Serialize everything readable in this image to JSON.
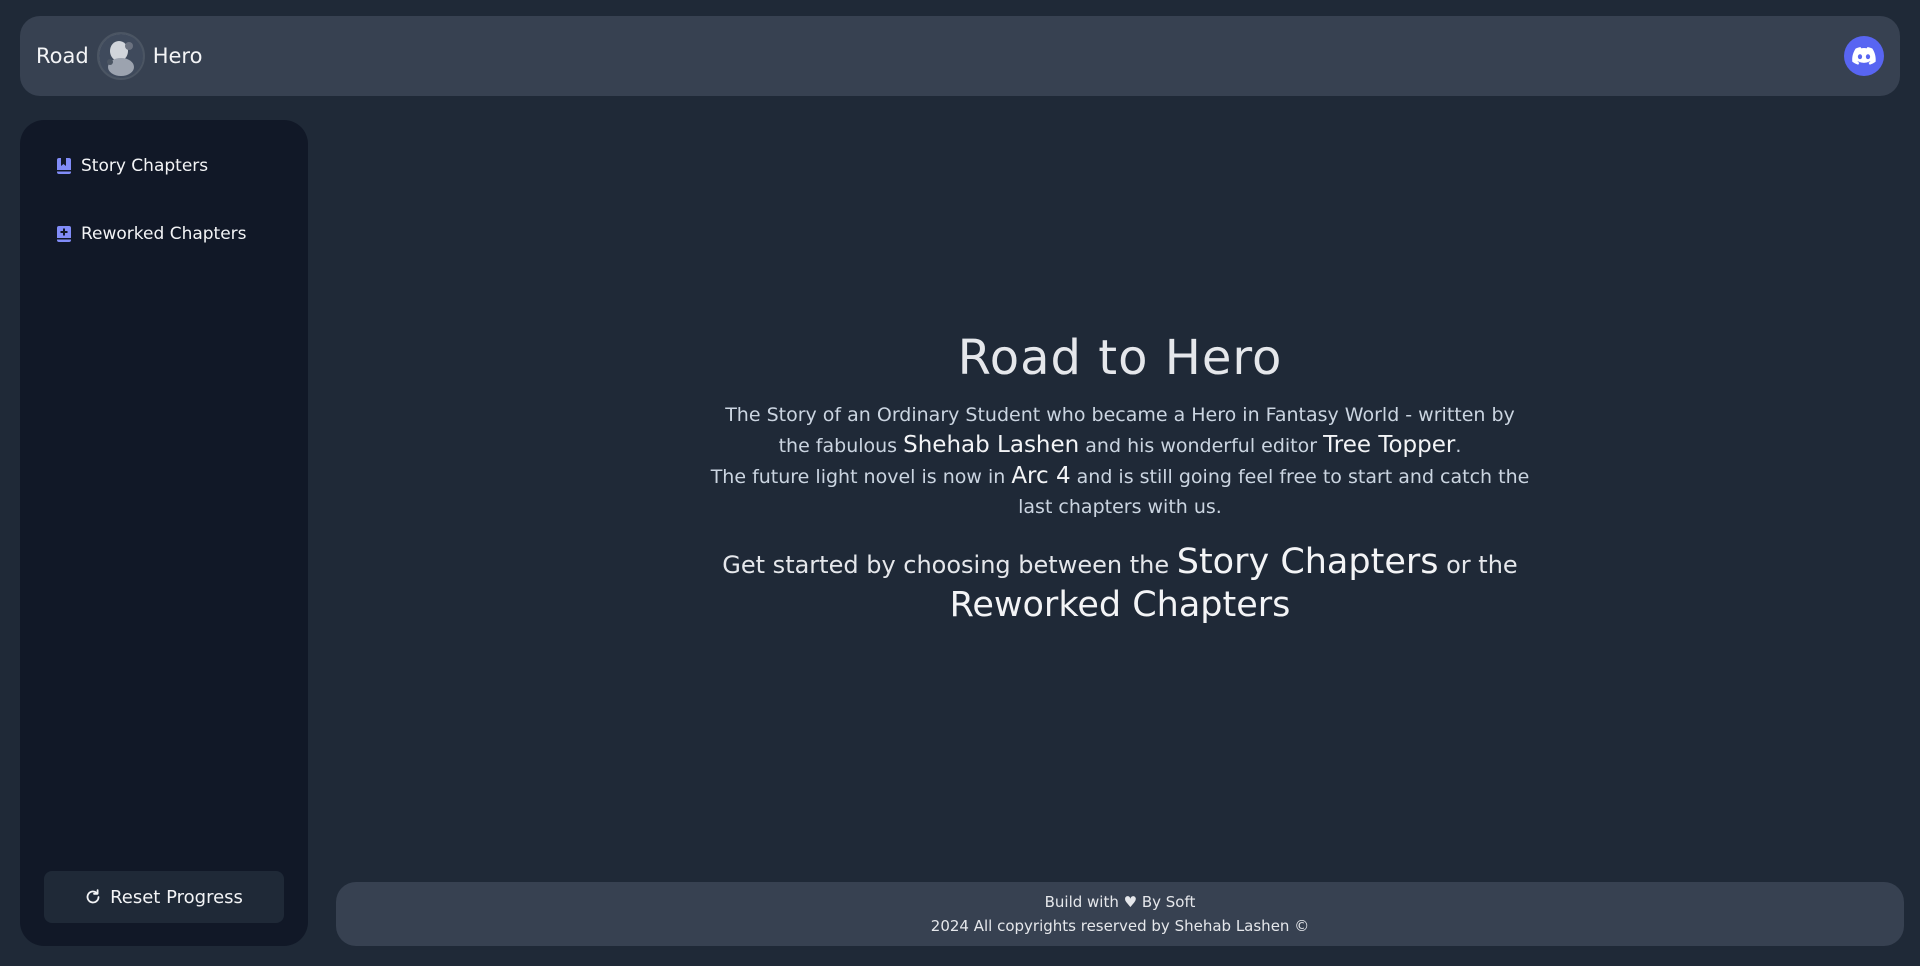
{
  "header": {
    "brand_left": "Road",
    "brand_right": "Hero",
    "discord_icon": "discord-icon"
  },
  "sidebar": {
    "items": [
      {
        "label": "Story Chapters",
        "icon": "book-icon"
      },
      {
        "label": "Reworked Chapters",
        "icon": "book-plus-icon"
      }
    ],
    "reset_label": "Reset Progress",
    "reset_icon": "refresh-icon"
  },
  "main": {
    "title": "Road to Hero",
    "desc_part1": "The Story of an Ordinary Student who became a Hero in Fantasy World - written by the fabulous",
    "author": "Shehab Lashen",
    "desc_part2": "and his wonderful editor",
    "editor": "Tree Topper",
    "desc_part3": ".",
    "desc_part4": "The future light novel is now in",
    "arc": "Arc 4",
    "desc_part5": "and is still going feel free to start and catch the last chapters with us.",
    "cta_part1": "Get started by choosing between the",
    "cta_story": "Story Chapters",
    "cta_part2": "or the",
    "cta_reworked": "Reworked Chapters"
  },
  "footer": {
    "line1": "Build with ♥ By Soft",
    "line2": "2024 All copyrights reserved by Shehab Lashen ©"
  },
  "colors": {
    "page_bg": "#1f2937",
    "panel_bg": "#374151",
    "sidebar_bg": "#111827",
    "icon_accent": "#818cf8",
    "discord": "#5865f2"
  }
}
